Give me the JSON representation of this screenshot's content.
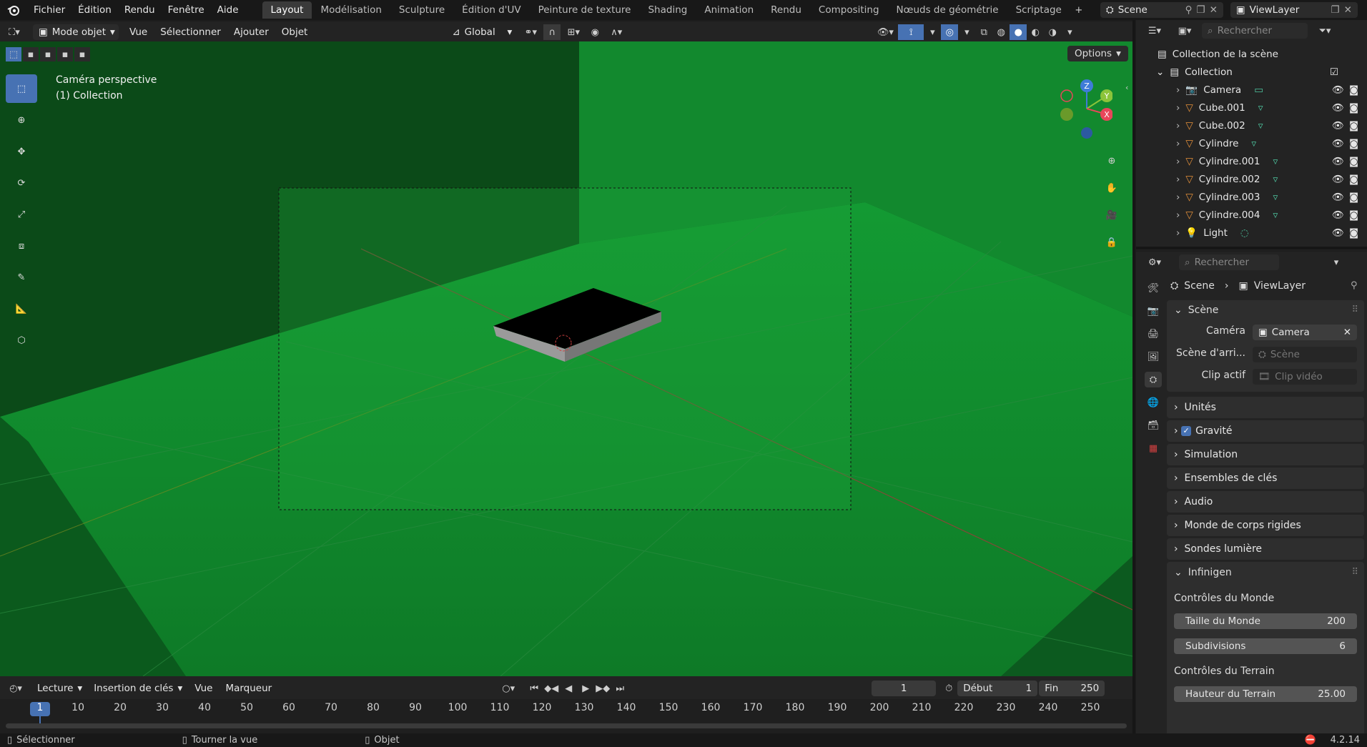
{
  "topmenu": {
    "items": [
      "Fichier",
      "Édition",
      "Rendu",
      "Fenêtre",
      "Aide"
    ]
  },
  "workspaces": [
    "Layout",
    "Modélisation",
    "Sculpture",
    "Édition d'UV",
    "Peinture de texture",
    "Shading",
    "Animation",
    "Rendu",
    "Compositing",
    "Nœuds de géométrie",
    "Scriptage"
  ],
  "scene": {
    "name": "Scene",
    "view_layer": "ViewLayer"
  },
  "viewport_header": {
    "mode": "Mode objet",
    "menus": [
      "Vue",
      "Sélectionner",
      "Ajouter",
      "Objet"
    ],
    "transform": "Global",
    "options": "Options"
  },
  "viewport_overlay": {
    "view_name": "Caméra perspective",
    "collection": "(1) Collection"
  },
  "gizmo": {
    "z": "Z",
    "y": "Y",
    "x": "X"
  },
  "outliner": {
    "search_placeholder": "Rechercher",
    "root": "Collection de la scène",
    "collection": "Collection",
    "items": [
      "Camera",
      "Cube.001",
      "Cube.002",
      "Cylindre",
      "Cylindre.001",
      "Cylindre.002",
      "Cylindre.003",
      "Cylindre.004",
      "Light"
    ]
  },
  "properties": {
    "search_placeholder": "Rechercher",
    "breadcrumb_scene": "Scene",
    "breadcrumb_layer": "ViewLayer",
    "scene_panel": {
      "title": "Scène",
      "camera_label": "Caméra",
      "camera_value": "Camera",
      "background_label": "Scène d'arri...",
      "background_placeholder": "Scène",
      "clip_label": "Clip actif",
      "clip_placeholder": "Clip vidéo"
    },
    "panels": [
      "Unités",
      "Gravité",
      "Simulation",
      "Ensembles de clés",
      "Audio",
      "Monde de corps rigides",
      "Sondes lumière"
    ],
    "infinigen": {
      "title": "Infinigen",
      "world_controls": "Contrôles du Monde",
      "world_size_label": "Taille du Monde",
      "world_size_value": "200",
      "subdiv_label": "Subdivisions",
      "subdiv_value": "6",
      "terrain_controls": "Contrôles du Terrain",
      "terrain_height_label": "Hauteur du Terrain",
      "terrain_height_value": "25.00"
    }
  },
  "timeline": {
    "menus": [
      "Lecture",
      "Insertion de clés",
      "Vue",
      "Marqueur"
    ],
    "current_frame": "1",
    "start_label": "Début",
    "start_value": "1",
    "end_label": "Fin",
    "end_value": "250",
    "ticks": [
      "1",
      "10",
      "20",
      "30",
      "40",
      "50",
      "60",
      "70",
      "80",
      "90",
      "100",
      "110",
      "120",
      "130",
      "140",
      "150",
      "160",
      "170",
      "180",
      "190",
      "200",
      "210",
      "220",
      "230",
      "240",
      "250"
    ]
  },
  "statusbar": {
    "select": "Sélectionner",
    "rotate": "Tourner la vue",
    "object": "Objet",
    "version": "4.2.14"
  },
  "colors": {
    "accent": "#4772b3",
    "viewport_green": "#0e8a2c",
    "axis_x": "#e8465a",
    "axis_y": "#8cc43a",
    "axis_z": "#3f7cd8"
  }
}
